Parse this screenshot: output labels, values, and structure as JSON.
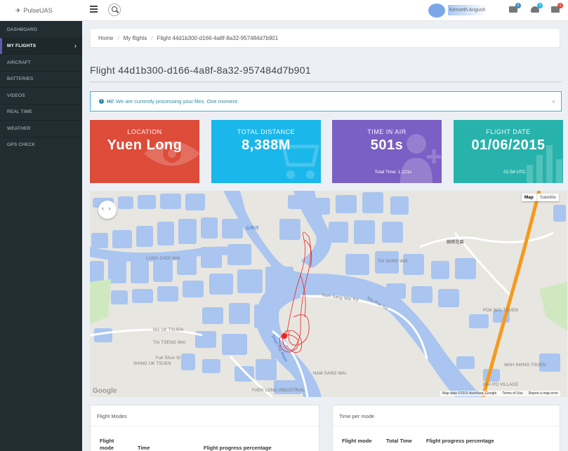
{
  "app": {
    "brand": "PulseUAS"
  },
  "topbar": {
    "user_name": "Kenneth Angush",
    "badges": {
      "messages": "2",
      "notifications": "3",
      "flags": "1"
    }
  },
  "sidebar": {
    "items": [
      {
        "label": "DASHBOARD"
      },
      {
        "label": "MY FLIGHTS"
      },
      {
        "label": "AIRCRAFT"
      },
      {
        "label": "BATTERIES"
      },
      {
        "label": "VIDEOS"
      },
      {
        "label": "REAL TIME"
      },
      {
        "label": "WEATHER"
      },
      {
        "label": "GPS CHECK"
      }
    ],
    "active_chevron": "›"
  },
  "breadcrumb": {
    "home": "Home",
    "section": "My flights",
    "current": "Flight 44d1b300-d166-4a8f-8a32-957484d7b901",
    "sep": "/"
  },
  "page": {
    "title": "Flight 44d1b300-d166-4a8f-8a32-957484d7b901"
  },
  "alert": {
    "strong": "Hi!",
    "text": "We are currently processing your files. One moment.",
    "close": "×",
    "icon": "info-icon"
  },
  "stats": [
    {
      "label": "LOCATION",
      "value": "Yuen Long",
      "sub": "",
      "color": "#dd4b39",
      "icon": "eye-icon"
    },
    {
      "label": "TOTAL DISTANCE",
      "value": "8,388M",
      "sub": "",
      "color": "#1ab7ea",
      "icon": "cart-icon"
    },
    {
      "label": "TIME IN AIR",
      "value": "501s",
      "sub": "Total Time: 1,121s",
      "color": "#7a5fc4",
      "icon": "user-add-icon"
    },
    {
      "label": "FLIGHT DATE",
      "value": "01/06/2015",
      "sub": "01:54 UTC",
      "color": "#27b3ab",
      "icon": "bar-chart-icon"
    }
  ],
  "map": {
    "type_map": "Map",
    "type_satellite": "Satellite",
    "google": "Google",
    "attribution": [
      "Map data ©2015 AutoNavi, Google",
      "Terms of Use",
      "Report a map error"
    ],
    "labels": [
      {
        "text": "LUNG CHOI WAI"
      },
      {
        "text": "TAI SANG WAI"
      },
      {
        "text": "NG UK TSUEN"
      },
      {
        "text": "TAI TSENG WAI"
      },
      {
        "text": "SHING UK TSUEN"
      },
      {
        "text": "NAM SANG WAI"
      },
      {
        "text": "YUEN LONG INDUSTRIAL"
      },
      {
        "text": "POK WAI TSUEN"
      },
      {
        "text": "WAH SHING TSUEN"
      },
      {
        "text": "MAI PO VILLAGE"
      },
      {
        "text": "Shan Pui River"
      },
      {
        "text": "Nam Sang Wai Rd"
      },
      {
        "text": "Yau Pok Rd"
      },
      {
        "text": "Fuk Shun St"
      },
      {
        "text": "錦綉花園"
      },
      {
        "text": "山貝河"
      }
    ],
    "colors": {
      "water": "#a9c5f0",
      "land": "#e8e6e0",
      "path": "#e8241f",
      "highway": "#f59a1b"
    }
  },
  "panels": {
    "modes": {
      "title": "Flight Modes",
      "cols": [
        "Flight mode",
        "Time",
        "Flight progress percentage"
      ]
    },
    "time": {
      "title": "Time per mode",
      "cols": [
        "Flight mode",
        "Total Time",
        "Flight progress percentage"
      ]
    }
  }
}
